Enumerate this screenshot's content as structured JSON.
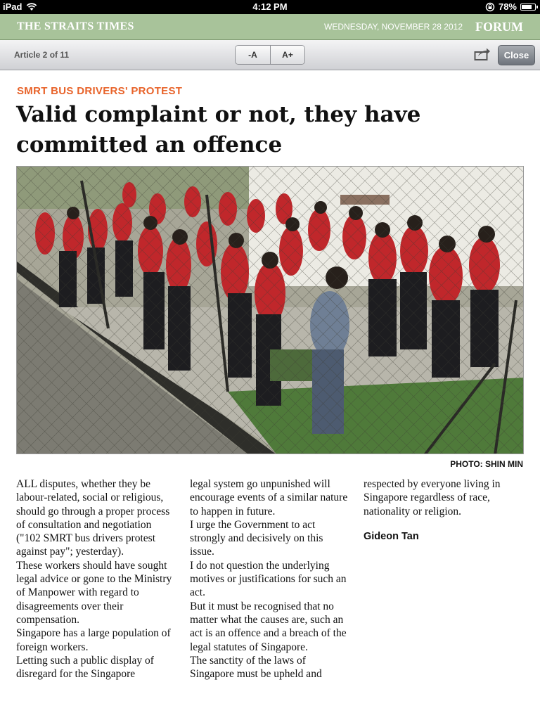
{
  "status_bar": {
    "device": "iPad",
    "time": "4:12 PM",
    "battery": "78%",
    "battery_level": 0.78
  },
  "masthead": {
    "brand": "THE STRAITS TIMES",
    "date": "WEDNESDAY, NOVEMBER 28 2012",
    "section": "FORUM"
  },
  "toolbar": {
    "counter": "Article 2 of 11",
    "decrease_font": "-A",
    "increase_font": "A+",
    "close": "Close"
  },
  "article": {
    "kicker": "SMRT BUS DRIVERS' PROTEST",
    "headline_line1": "Valid complaint or not, they have",
    "headline_line2": "committed an offence",
    "photo_credit": "PHOTO: SHIN MIN",
    "columns": [
      [
        "ALL disputes, whether they be labour-related, social or religious, should go through a proper process of consultation and negotiation (\"102 SMRT bus drivers protest against pay\"; yesterday).",
        " These workers should have sought legal advice or gone to the Ministry of Manpower with regard to disagreements over their compensation.",
        " Singapore has a large population of foreign workers.",
        " Letting such a public display of disregard for the Singapore"
      ],
      [
        "legal system go unpunished will encourage events of a similar nature to happen in future.",
        " I urge the Government to act strongly and decisively on this issue.",
        " I do not question the underlying motives or justifications for such an act.",
        " But it must be recognised that no matter what the causes are, such an act is an offence and a breach of the legal statutes of Singapore.",
        " The sanctity of the laws of Singapore must be upheld and"
      ],
      [
        "respected by everyone living in Singapore regardless of race, nationality or religion."
      ]
    ],
    "author": "Gideon Tan"
  }
}
